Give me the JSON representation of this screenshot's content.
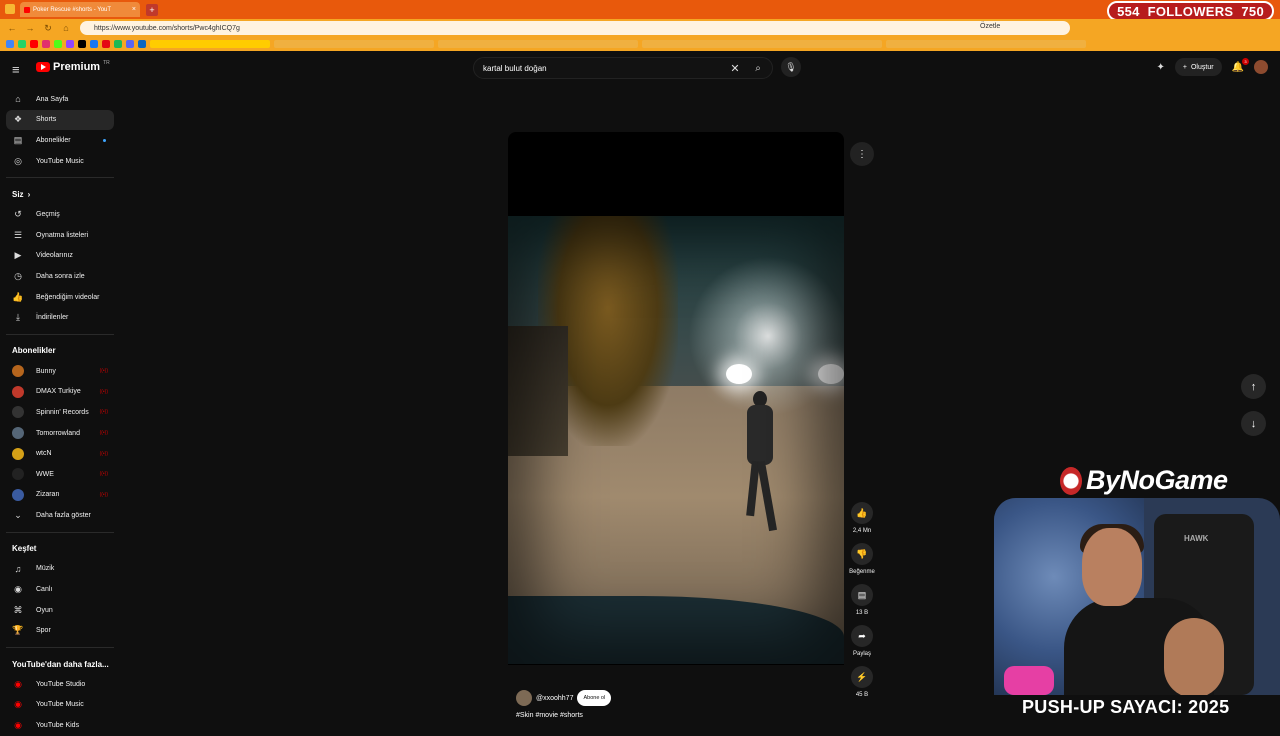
{
  "browser": {
    "tab_title": "Poker Rescue #shorts - YouT",
    "url": "https://www.youtube.com/shorts/Pwc4ghICQ7g",
    "summarize_label": "Özetle"
  },
  "overlay": {
    "followers_current": "554",
    "followers_label": "FOLLOWERS",
    "followers_goal": "750",
    "brand": "ByNoGame",
    "pushup_counter": "PUSH-UP SAYACI: 2025",
    "chair_brand": "HAWK"
  },
  "youtube": {
    "logo_text": "Premium",
    "logo_region": "TR",
    "search_query": "kartal bulut doğan",
    "create_label": "Oluştur",
    "notification_count": "3"
  },
  "sidebar": {
    "main": [
      {
        "label": "Ana Sayfa",
        "icon": "home-icon"
      },
      {
        "label": "Shorts",
        "icon": "shorts-icon"
      },
      {
        "label": "Abonelikler",
        "icon": "subscriptions-icon"
      },
      {
        "label": "YouTube Music",
        "icon": "music-icon"
      }
    ],
    "you_title": "Siz",
    "you": [
      {
        "label": "Geçmiş",
        "icon": "history-icon"
      },
      {
        "label": "Oynatma listeleri",
        "icon": "playlist-icon"
      },
      {
        "label": "Videolarınız",
        "icon": "your-videos-icon"
      },
      {
        "label": "Daha sonra izle",
        "icon": "watch-later-icon"
      },
      {
        "label": "Beğendiğim videolar",
        "icon": "liked-icon"
      },
      {
        "label": "İndirilenler",
        "icon": "download-icon"
      }
    ],
    "subs_title": "Abonelikler",
    "subs": [
      {
        "label": "Bunny",
        "color": "#b5651d"
      },
      {
        "label": "DMAX Turkiye",
        "color": "#c0392b"
      },
      {
        "label": "Spinnin' Records",
        "color": "#333333"
      },
      {
        "label": "Tomorrowland",
        "color": "#556677"
      },
      {
        "label": "wtcN",
        "color": "#d4a017"
      },
      {
        "label": "WWE",
        "color": "#222222"
      },
      {
        "label": "Zizaran",
        "color": "#3a5ba0"
      }
    ],
    "show_more": "Daha fazla göster",
    "explore_title": "Keşfet",
    "explore": [
      {
        "label": "Müzik",
        "icon": "music-note-icon"
      },
      {
        "label": "Canlı",
        "icon": "live-icon"
      },
      {
        "label": "Oyun",
        "icon": "gaming-icon"
      },
      {
        "label": "Spor",
        "icon": "trophy-icon"
      }
    ],
    "more_title": "YouTube'dan daha fazla...",
    "more": [
      {
        "label": "YouTube Studio"
      },
      {
        "label": "YouTube Music"
      },
      {
        "label": "YouTube Kids"
      }
    ]
  },
  "short": {
    "like_count": "2,4 Mn",
    "dislike_label": "Beğenme",
    "comment_count": "13 B",
    "share_label": "Paylaş",
    "remix_count": "45 B",
    "channel": "@xxoohh77",
    "subscribe_label": "Abone ol",
    "tags": "#Skin #movie #shorts"
  }
}
